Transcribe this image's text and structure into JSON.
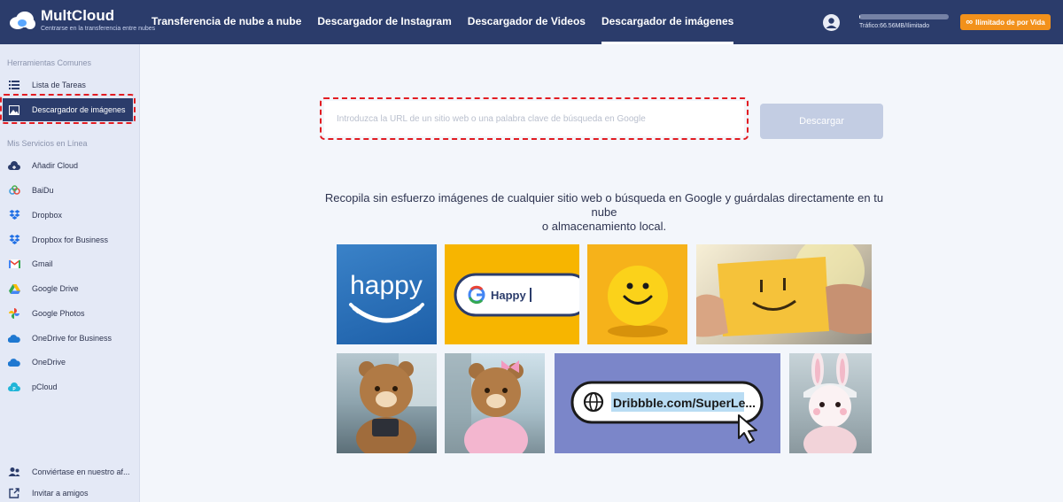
{
  "header": {
    "logo_title": "MultCloud",
    "logo_subtitle": "Centrarse en la transferencia entre nubes",
    "nav": [
      {
        "label": "Transferencia de nube a nube",
        "active": false
      },
      {
        "label": "Descargador de Instagram",
        "active": false
      },
      {
        "label": "Descargador de Videos",
        "active": false
      },
      {
        "label": "Descargador de imágenes",
        "active": true
      }
    ],
    "traffic_text": "Tráfico:66.56MB/Ilimitado",
    "traffic_fraction": 0.01,
    "upgrade_label": "Ilimitado de por Vida"
  },
  "sidebar": {
    "section1_title": "Herramientas Comunes",
    "tools": [
      {
        "label": "Lista de Tareas",
        "icon": "list-icon"
      },
      {
        "label": "Descargador de imágenes",
        "icon": "image-icon",
        "active": true
      }
    ],
    "section2_title": "Mis Servicios en Línea",
    "services": [
      {
        "label": "Añadir Cloud",
        "icon": "add-cloud-icon"
      },
      {
        "label": "BaiDu",
        "icon": "baidu-icon"
      },
      {
        "label": "Dropbox",
        "icon": "dropbox-icon"
      },
      {
        "label": "Dropbox for Business",
        "icon": "dropbox-business-icon"
      },
      {
        "label": "Gmail",
        "icon": "gmail-icon"
      },
      {
        "label": "Google Drive",
        "icon": "google-drive-icon"
      },
      {
        "label": "Google Photos",
        "icon": "google-photos-icon"
      },
      {
        "label": "OneDrive for Business",
        "icon": "onedrive-business-icon"
      },
      {
        "label": "OneDrive",
        "icon": "onedrive-icon"
      },
      {
        "label": "pCloud",
        "icon": "pcloud-icon"
      }
    ],
    "bottom": [
      {
        "label": "Conviértase en nuestro af...",
        "icon": "affiliate-icon"
      },
      {
        "label": "Invitar a amigos",
        "icon": "invite-icon"
      }
    ]
  },
  "main": {
    "url_placeholder": "Introduzca la URL de un sitio web o una palabra clave de búsqueda en Google",
    "download_label": "Descargar",
    "description_line1": "Recopila sin esfuerzo imágenes de cualquier sitio web o búsqueda en Google y guárdalas directamente en tu nube",
    "description_line2": "o almacenamiento local.",
    "tiles": {
      "happy_word": "happy",
      "google_search_text": "Happy",
      "dribbble_url": "Dribbble.com/SuperLe..."
    }
  },
  "colors": {
    "header_bg": "#2b3c6b",
    "accent_orange": "#f2911b",
    "highlight_red": "#e21c22",
    "download_btn": "#c3cde3"
  }
}
